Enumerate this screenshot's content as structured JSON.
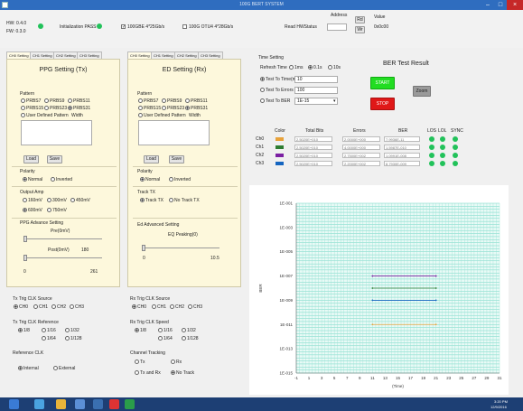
{
  "window": {
    "title": "100G BERT SYSTEM",
    "minimize": "–",
    "maximize": "□",
    "close": "×"
  },
  "header": {
    "hw_label": "HW: 0.4.0",
    "fw_label": "FW: 0.3.0",
    "init_label": "Initialization PASS",
    "mode1": "100GBE 4*25Gb/s",
    "mode2": "100G OTU4 4*28Gb/s",
    "read_btn": "Read HWStatus",
    "address_label": "Address",
    "value_label": "Value",
    "rd_btn": "Rd",
    "wr_btn": "Wr",
    "value_text": "0x0c00"
  },
  "tabs_left": [
    "CH0 Setting",
    "CH1 Setting",
    "CH2 Setting",
    "CH3 Setting"
  ],
  "tabs_right": [
    "CH0 Setting",
    "CH1 Setting",
    "CH2 Setting",
    "CH3 Setting"
  ],
  "ppg": {
    "title": "PPG Setting (Tx)",
    "pattern_label": "Pattern",
    "patterns": [
      "PRBS7",
      "PRBS9",
      "PRBS11",
      "PRBS15",
      "PRBS23",
      "PRBS31"
    ],
    "user_label": "User Defined Pattern",
    "width_label": "Width",
    "load": "Load",
    "save": "Save",
    "polarity_label": "Polarity",
    "pol_normal": "Normal",
    "pol_inverted": "Inverted",
    "amp_label": "Output Amp",
    "amps": [
      "160mV",
      "300mV",
      "450mV",
      "600mV",
      "750mV"
    ],
    "adv_label": "PPG Advance Setting",
    "pre_label": "Pre(0mV)",
    "post_label": "Post(0mV)",
    "post_val": "180",
    "min_val": "0",
    "max_val": "261"
  },
  "ed": {
    "title": "ED Setting (Rx)",
    "pattern_label": "Pattern",
    "patterns": [
      "PRBS7",
      "PRBS9",
      "PRBS11",
      "PRBS15",
      "PRBS23",
      "PRBS31"
    ],
    "user_label": "User Defined Pattern",
    "width_label": "Width",
    "load": "Load",
    "save": "Save",
    "polarity_label": "Polarity",
    "pol_normal": "Normal",
    "pol_inverted": "Inverted",
    "track_label": "Track TX",
    "track1": "Track TX",
    "track2": "No Track TX",
    "adv_label": "Ed Advanced Setting",
    "eq_label": "EQ Peaking(0)",
    "min_val": "0",
    "max_val": "10.5"
  },
  "clk_left": {
    "src_label": "Tx Trig CLK Source",
    "src_opts": [
      "CH0",
      "CH1",
      "CH2",
      "CH3"
    ],
    "ref_label": "Tx Trig CLK Reference",
    "ref_opts": [
      "1/8",
      "1/16",
      "1/32",
      "1/64",
      "1/128"
    ],
    "refclk_label": "Reference CLK",
    "refclk_opts": [
      "Internal",
      "External"
    ]
  },
  "clk_right": {
    "src_label": "Rx Trig CLK Source",
    "src_opts": [
      "CH0",
      "CH1",
      "CH2",
      "CH3"
    ],
    "spd_label": "Rx Trig CLK Speed",
    "spd_opts": [
      "1/8",
      "1/16",
      "1/32",
      "1/64",
      "1/128"
    ],
    "ct_label": "Channel Tracking",
    "ct_opts": [
      "Tx",
      "Rx",
      "Tx and Rx",
      "No Track"
    ]
  },
  "timing": {
    "title": "Time Setting",
    "refresh_label": "Refresh Time",
    "refresh_opts": [
      "1ms",
      "0.1s",
      "10s"
    ],
    "test_time": "Test To Time(ms)",
    "test_time_val": "10",
    "test_errors": "Test To Errors",
    "test_errors_val": "100",
    "test_ber": "Test To BER",
    "test_ber_val": "1E-15"
  },
  "ber": {
    "title": "BER Test Result",
    "start": "START",
    "stop": "STOP",
    "zoom": "Zoom"
  },
  "table": {
    "headers": [
      "Color",
      "Total Bits",
      "Errors",
      "BER",
      "LOS",
      "LOL",
      "SYNC"
    ],
    "rows": [
      {
        "ch": "Ch0",
        "color": "#e8a23a",
        "bits": "2.5020E+010",
        "errors": "2.0000E+000",
        "ber": "7.9936E-11"
      },
      {
        "ch": "Ch1",
        "color": "#2e7d32",
        "bits": "2.5020E+010",
        "errors": "4.0000E+000",
        "ber": "1.5987E-010"
      },
      {
        "ch": "Ch2",
        "color": "#7b1fa2",
        "bits": "2.5020E+010",
        "errors": "2.7500E+002",
        "ber": "1.0991E-008"
      },
      {
        "ch": "Ch3",
        "color": "#1565c0",
        "bits": "2.5020E+010",
        "errors": "2.2000E+002",
        "ber": "8.7930E-009"
      }
    ]
  },
  "chart_data": {
    "type": "line",
    "ylabel": "BER",
    "xlabel": "(Time)",
    "y_ticks": [
      "1E-001",
      "1E-003",
      "1E-005",
      "1E-007",
      "1E-009",
      "1E-011",
      "1E-013",
      "1E-015"
    ],
    "x_ticks": [
      "-1",
      "1",
      "3",
      "5",
      "7",
      "9",
      "11",
      "13",
      "15",
      "17",
      "19",
      "21",
      "23",
      "25",
      "27",
      "29",
      "31"
    ],
    "grid": true,
    "series": [
      {
        "color": "#7b1fa2",
        "x": [
          11,
          21
        ],
        "y": [
          1e-07,
          1e-07
        ]
      },
      {
        "color": "#2e7d32",
        "x": [
          11,
          21
        ],
        "y": [
          1e-08,
          1e-08
        ]
      },
      {
        "color": "#1565c0",
        "x": [
          11,
          21
        ],
        "y": [
          1e-09,
          1e-09
        ]
      },
      {
        "color": "#e8a23a",
        "x": [
          11,
          21
        ],
        "y": [
          1e-11,
          1e-11
        ]
      }
    ]
  },
  "taskbar": {
    "time": "3:20 PM",
    "date": "12/9/2016"
  }
}
